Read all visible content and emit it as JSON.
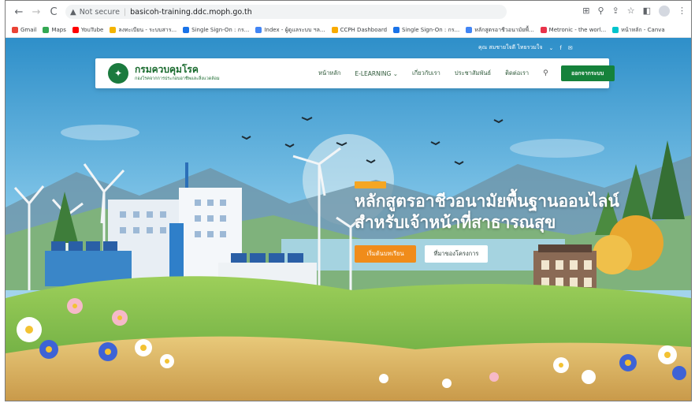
{
  "browser": {
    "url_warning": "Not secure",
    "url": "basicoh-training.ddc.moph.go.th",
    "bookmarks": [
      {
        "label": "Gmail",
        "color": "#ea4335"
      },
      {
        "label": "Maps",
        "color": "#34a853"
      },
      {
        "label": "YouTube",
        "color": "#ff0000"
      },
      {
        "label": "ลงทะเบียน - ระบบสาร...",
        "color": "#f4b400"
      },
      {
        "label": "Single Sign-On : กร...",
        "color": "#1a73e8"
      },
      {
        "label": "Index - ผู้ดูแลระบบ ฯล...",
        "color": "#4285f4"
      },
      {
        "label": "CCPH Dashboard",
        "color": "#f9ab00"
      },
      {
        "label": "Single Sign-On : กร...",
        "color": "#1a73e8"
      },
      {
        "label": "หลักสูตรอาชีวอนามัยพื้...",
        "color": "#4285f4"
      },
      {
        "label": "Metronic - the worl...",
        "color": "#e8334a"
      },
      {
        "label": "หน้าหลัก - Canva",
        "color": "#00c4cc"
      }
    ]
  },
  "site": {
    "utility_user": "คุณ สมชายใจดี ไทยรวมใจ",
    "brand_title": "กรมควบคุมโรค",
    "brand_subtitle": "กองโรคจากการประกอบอาชีพและสิ่งแวดล้อม",
    "menu": [
      "หน้าหลัก",
      "E-LEARNING",
      "เกี่ยวกับเรา",
      "ประชาสัมพันธ์",
      "ติดต่อเรา"
    ],
    "logout_label": "ออกจากระบบ",
    "hero_title_1": "หลักสูตรอาชีวอนามัยพื้นฐานออนไลน์",
    "hero_title_2": "สำหรับเจ้าหน้าที่สาธารณสุข",
    "cta_primary": "เริ่มต้นบทเรียน",
    "cta_secondary": "ที่มาของโครงการ"
  }
}
